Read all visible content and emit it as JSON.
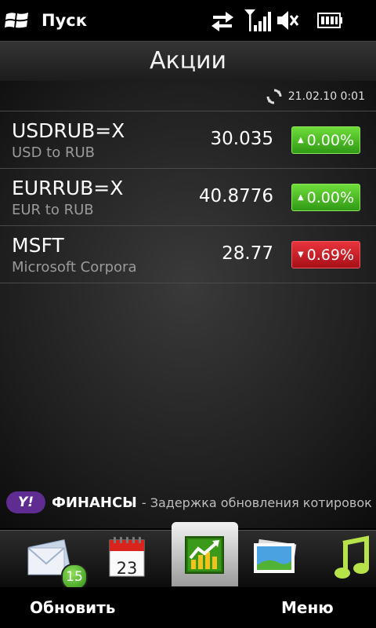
{
  "status": {
    "start_label": "Пуск"
  },
  "app": {
    "title": "Акции",
    "updated": "21.02.10 0:01"
  },
  "stocks": [
    {
      "symbol": "USDRUB=X",
      "name": "USD to RUB",
      "price": "30.035",
      "change": "0.00%",
      "direction": "up"
    },
    {
      "symbol": "EURRUB=X",
      "name": "EUR to RUB",
      "price": "40.8776",
      "change": "0.00%",
      "direction": "up"
    },
    {
      "symbol": "MSFT",
      "name": "Microsoft Corpora",
      "price": "28.77",
      "change": "0.69%",
      "direction": "down"
    }
  ],
  "footer": {
    "logo_text": "Y!",
    "brand": "ФИНАНСЫ",
    "note": "- Задержка обновления котировок"
  },
  "tabs": {
    "mail_badge": "15",
    "calendar_day": "23"
  },
  "softkeys": {
    "left": "Обновить",
    "right": "Меню"
  },
  "colors": {
    "up": "#3fae1e",
    "down": "#c4141c",
    "yahoo": "#5f2c91"
  },
  "icons": [
    "windows-logo-icon",
    "data-connection-icon",
    "signal-icon",
    "volume-muted-icon",
    "battery-icon",
    "refresh-icon",
    "mail-icon",
    "calendar-icon",
    "stocks-icon",
    "photos-icon",
    "music-icon"
  ]
}
